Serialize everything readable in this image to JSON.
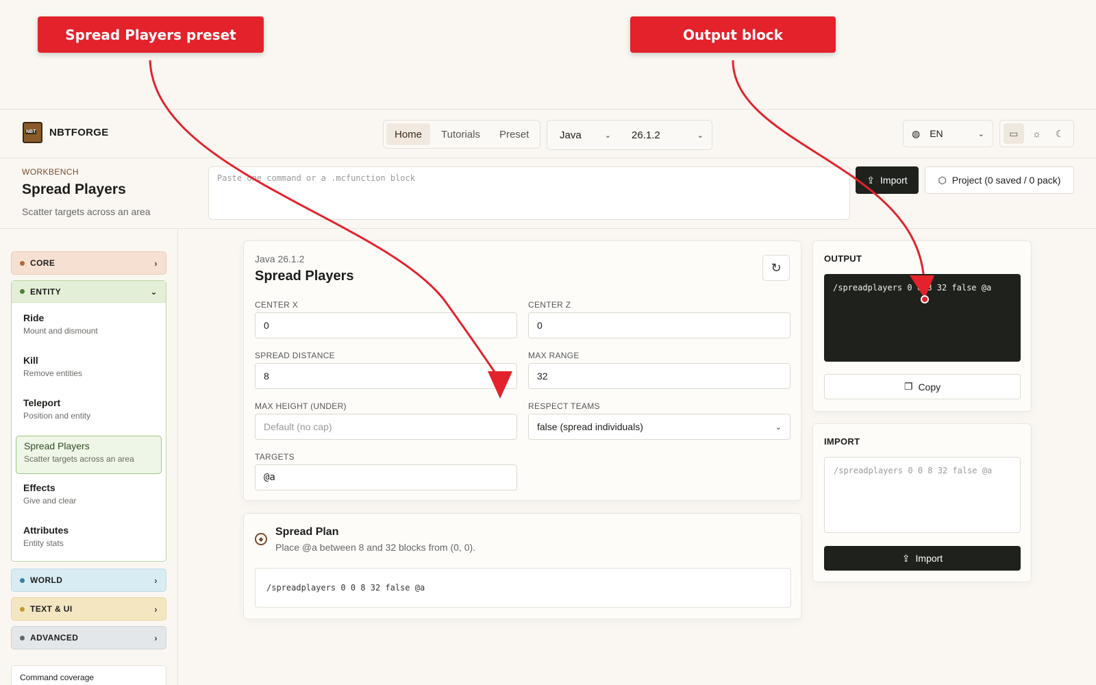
{
  "callouts": {
    "preset": "Spread Players preset",
    "output": "Output block"
  },
  "header": {
    "brand": "NBTFORGE",
    "nav": [
      "Home",
      "Tutorials",
      "Preset"
    ],
    "edition": "Java",
    "version": "26.1.2",
    "language": "EN"
  },
  "workbench": {
    "label": "WORKBENCH",
    "title": "Spread Players",
    "subtitle": "Scatter targets across an area",
    "paste_placeholder": "Paste one command or a .mcfunction block",
    "import_label": "Import",
    "project_label": "Project (0 saved / 0 pack)"
  },
  "sidebar": {
    "categories": {
      "core": "CORE",
      "entity": "ENTITY",
      "world": "WORLD",
      "text_ui": "TEXT & UI",
      "advanced": "ADVANCED"
    },
    "items": [
      {
        "title": "Ride",
        "desc": "Mount and dismount"
      },
      {
        "title": "Kill",
        "desc": "Remove entities"
      },
      {
        "title": "Teleport",
        "desc": "Position and entity"
      },
      {
        "title": "Spread Players",
        "desc": "Scatter targets across an area"
      },
      {
        "title": "Effects",
        "desc": "Give and clear"
      },
      {
        "title": "Attributes",
        "desc": "Entity stats"
      }
    ],
    "coverage": "Command coverage"
  },
  "editor": {
    "version": "Java 26.1.2",
    "title": "Spread Players",
    "fields": {
      "center_x": {
        "label": "CENTER X",
        "value": "0"
      },
      "center_z": {
        "label": "CENTER Z",
        "value": "0"
      },
      "spread_distance": {
        "label": "SPREAD DISTANCE",
        "value": "8"
      },
      "max_range": {
        "label": "MAX RANGE",
        "value": "32"
      },
      "max_height": {
        "label": "MAX HEIGHT (UNDER)",
        "placeholder": "Default (no cap)"
      },
      "respect_teams": {
        "label": "RESPECT TEAMS",
        "value": "false (spread individuals)"
      },
      "targets": {
        "label": "TARGETS",
        "value": "@a"
      }
    }
  },
  "plan": {
    "title": "Spread Plan",
    "subtitle": "Place @a between 8 and 32 blocks from (0, 0).",
    "command": "/spreadplayers 0 0 8 32 false @a"
  },
  "output": {
    "label": "OUTPUT",
    "command": "/spreadplayers 0 0 8 32 false @a",
    "copy_label": "Copy"
  },
  "import": {
    "label": "IMPORT",
    "placeholder": "/spreadplayers 0 0 8 32 false @a",
    "button_label": "Import"
  },
  "colors": {
    "accent_red": "#e3222b",
    "dark_button": "#1f211c",
    "core": "#f6e0d2",
    "entity": "#e3efd6",
    "world": "#d8ecf3",
    "text_ui": "#f5e6c2",
    "advanced": "#e4e7ea"
  }
}
